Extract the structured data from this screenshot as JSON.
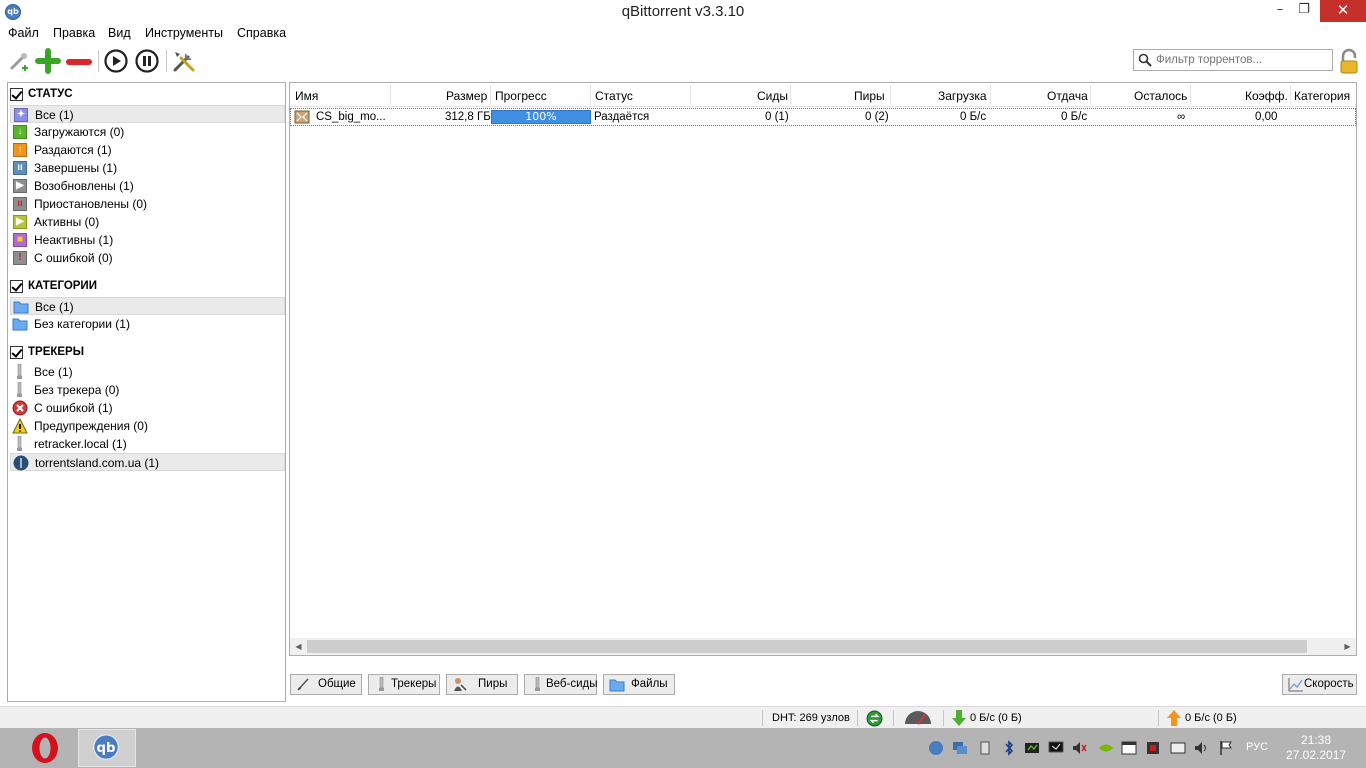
{
  "window": {
    "title": "qBittorrent v3.3.10",
    "app_icon_text": "qb",
    "minimize": "–",
    "maximize": "❐",
    "close": "✕"
  },
  "menu": [
    "Файл",
    "Правка",
    "Вид",
    "Инструменты",
    "Справка"
  ],
  "toolbar": {
    "search_placeholder": "Фильтр торрентов..."
  },
  "sidebar": {
    "status": {
      "header": "СТАТУС",
      "items": [
        {
          "label": "Все (1)",
          "icon": "all-icon",
          "color": "#8a8ee6"
        },
        {
          "label": "Загружаются (0)",
          "icon": "download-arrow-icon",
          "color": "#5bb62d"
        },
        {
          "label": "Раздаются (1)",
          "icon": "upload-arrow-icon",
          "color": "#f0961c"
        },
        {
          "label": "Завершены (1)",
          "icon": "completed-icon",
          "color": "#5e8db7"
        },
        {
          "label": "Возобновлены (1)",
          "icon": "resumed-icon",
          "color": "#8e8e8e"
        },
        {
          "label": "Приостановлены (0)",
          "icon": "paused-icon",
          "color": "#8e8e8e"
        },
        {
          "label": "Активны (0)",
          "icon": "active-icon",
          "color": "#b0c836"
        },
        {
          "label": "Неактивны (1)",
          "icon": "inactive-icon",
          "color": "#b06ad0"
        },
        {
          "label": "С ошибкой (0)",
          "icon": "error-icon",
          "color": "#8e8e8e"
        }
      ]
    },
    "categories": {
      "header": "КАТЕГОРИИ",
      "items": [
        {
          "label": "Все (1)",
          "icon": "folder-icon"
        },
        {
          "label": "Без категории (1)",
          "icon": "folder-icon"
        }
      ]
    },
    "trackers": {
      "header": "ТРЕКЕРЫ",
      "items": [
        {
          "label": "Все (1)",
          "icon": "tracker-icon"
        },
        {
          "label": "Без трекера (0)",
          "icon": "tracker-icon"
        },
        {
          "label": "С ошибкой (1)",
          "icon": "error-circle-icon"
        },
        {
          "label": "Предупреждения (0)",
          "icon": "warning-icon"
        },
        {
          "label": "retracker.local (1)",
          "icon": "tracker-icon"
        },
        {
          "label": "torrentsland.com.ua (1)",
          "icon": "site-favicon-icon"
        }
      ]
    }
  },
  "table": {
    "columns": [
      "Имя",
      "Размер",
      "Прогресс",
      "Статус",
      "Сиды",
      "Пиры",
      "Загрузка",
      "Отдача",
      "Осталось",
      "Коэфф.",
      "Категория"
    ],
    "rows": [
      {
        "name": "CS_big_mo...",
        "size": "312,8 ГБ",
        "progress_text": "100%",
        "progress": 1.0,
        "status": "Раздаётся",
        "seeds": "0 (1)",
        "peers": "0 (2)",
        "download": "0 Б/с",
        "upload": "0 Б/с",
        "eta": "∞",
        "ratio": "0,00",
        "category": ""
      }
    ]
  },
  "bottom_tabs": [
    "Общие",
    "Трекеры",
    "Пиры",
    "Веб-сиды",
    "Файлы"
  ],
  "speed_button": "Скорость",
  "statusbar": {
    "dht": "DHT: 269 узлов",
    "download": "0 Б/с (0 Б)",
    "upload": "0 Б/с (0 Б)"
  },
  "taskbar": {
    "lang": "РУС",
    "time": "21:38",
    "date": "27.02.2017"
  },
  "colors": {
    "progress": "#3f8fe3",
    "close_button": "#c7302a",
    "taskbar": "#b4b4b4"
  }
}
